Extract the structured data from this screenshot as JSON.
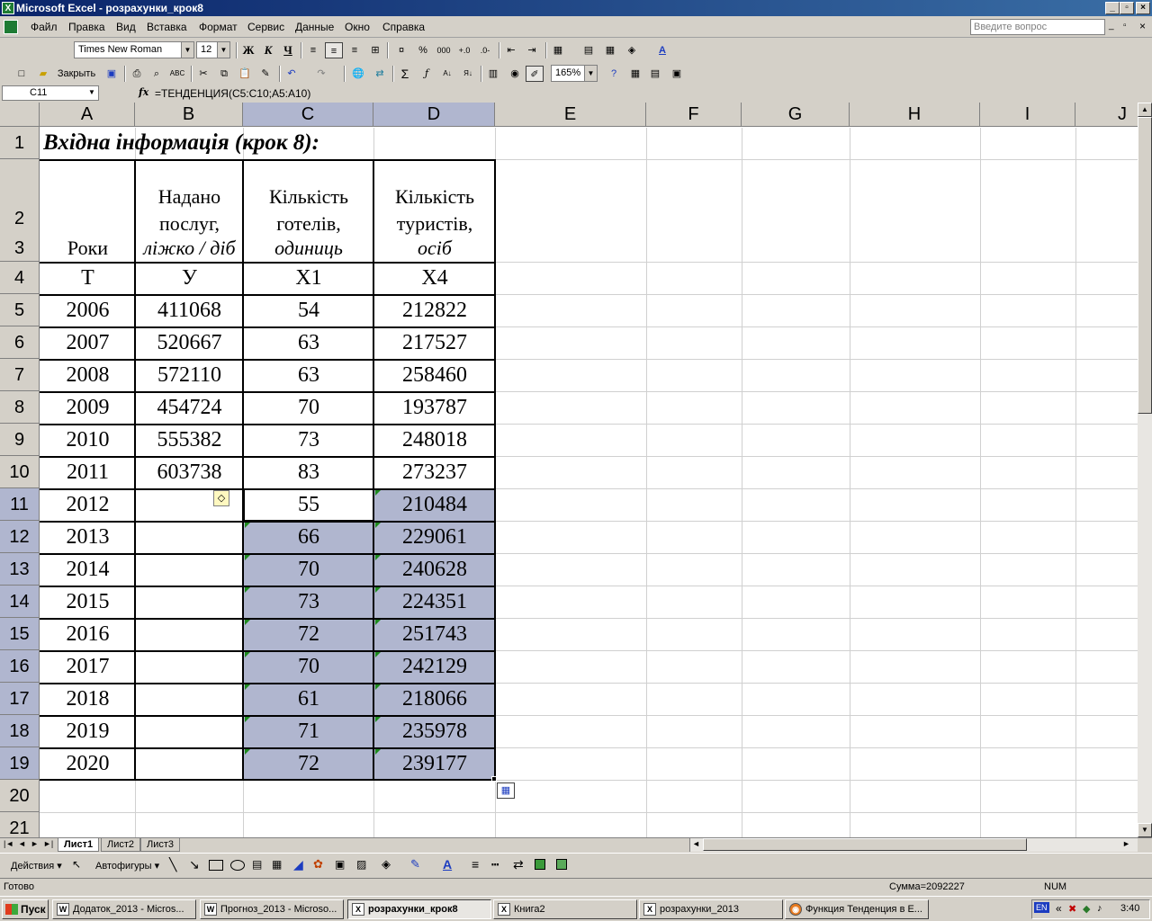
{
  "window": {
    "title": "Microsoft Excel - розрахунки_крок8",
    "minimize": "_",
    "maximize": "▫",
    "close": "×"
  },
  "menu": {
    "items": [
      "Файл",
      "Правка",
      "Вид",
      "Вставка",
      "Формат",
      "Сервис",
      "Данные",
      "Окно",
      "Справка"
    ],
    "ask_placeholder": "Введите вопрос"
  },
  "toolbar": {
    "font_name": "Times New Roman",
    "font_size": "12",
    "bold": "Ж",
    "italic": "К",
    "underline": "Ч",
    "percent": "%",
    "thousands": "000",
    "close_label": "Закрыть",
    "sigma": "Σ",
    "zoom": "165%"
  },
  "formula_bar": {
    "name_box": "C11",
    "fx": "fx",
    "formula": "=ТЕНДЕНЦИЯ(C5:C10;A5:A10)"
  },
  "columns": [
    "A",
    "B",
    "C",
    "D",
    "E",
    "F",
    "G",
    "H",
    "I",
    "J"
  ],
  "rows": [
    "1",
    "2",
    "3",
    "4",
    "5",
    "6",
    "7",
    "8",
    "9",
    "10",
    "11",
    "12",
    "13",
    "14",
    "15",
    "16",
    "17",
    "18",
    "19",
    "20",
    "21"
  ],
  "sheet": {
    "title": "Вхідна інформація (крок 8):",
    "headers": {
      "a": "Роки",
      "b_line1": "Надано",
      "b_line2": "послуг,",
      "b_line3": "ліжко / діб",
      "c_line1": "Кількість",
      "c_line2": "готелів,",
      "c_line3": "одиниць",
      "d_line1": "Кількість",
      "d_line2": "туристів,",
      "d_line3": "осіб"
    },
    "symbols": [
      "T",
      "У",
      "X1",
      "X4"
    ],
    "data_rows": [
      {
        "year": "2006",
        "services": "411068",
        "hotels": "54",
        "tourists": "212822"
      },
      {
        "year": "2007",
        "services": "520667",
        "hotels": "63",
        "tourists": "217527"
      },
      {
        "year": "2008",
        "services": "572110",
        "hotels": "63",
        "tourists": "258460"
      },
      {
        "year": "2009",
        "services": "454724",
        "hotels": "70",
        "tourists": "193787"
      },
      {
        "year": "2010",
        "services": "555382",
        "hotels": "73",
        "tourists": "248018"
      },
      {
        "year": "2011",
        "services": "603738",
        "hotels": "83",
        "tourists": "273237"
      },
      {
        "year": "2012",
        "services": "",
        "hotels": "55",
        "tourists": "210484"
      },
      {
        "year": "2013",
        "services": "",
        "hotels": "66",
        "tourists": "229061"
      },
      {
        "year": "2014",
        "services": "",
        "hotels": "70",
        "tourists": "240628"
      },
      {
        "year": "2015",
        "services": "",
        "hotels": "73",
        "tourists": "224351"
      },
      {
        "year": "2016",
        "services": "",
        "hotels": "72",
        "tourists": "251743"
      },
      {
        "year": "2017",
        "services": "",
        "hotels": "70",
        "tourists": "242129"
      },
      {
        "year": "2018",
        "services": "",
        "hotels": "61",
        "tourists": "218066"
      },
      {
        "year": "2019",
        "services": "",
        "hotels": "71",
        "tourists": "235978"
      },
      {
        "year": "2020",
        "services": "",
        "hotels": "72",
        "tourists": "239177"
      }
    ]
  },
  "tabs": [
    "Лист1",
    "Лист2",
    "Лист3"
  ],
  "drawing_toolbar": {
    "actions": "Действия",
    "autoshapes": "Автофигуры"
  },
  "status": {
    "ready": "Готово",
    "sum": "Сумма=2092227",
    "num": "NUM"
  },
  "taskbar": {
    "start": "Пуск",
    "buttons": [
      "Додаток_2013 - Micros...",
      "Прогноз_2013 - Microso...",
      "розрахунки_крок8",
      "Книга2",
      "розрахунки_2013",
      "Функция Тенденция в E..."
    ],
    "lang": "EN",
    "clock": "3:40"
  },
  "colors": {
    "selection": "#b0b6cf",
    "titlebar_start": "#0a246a",
    "titlebar_end": "#3a6ea5",
    "face": "#d4d0c8"
  }
}
